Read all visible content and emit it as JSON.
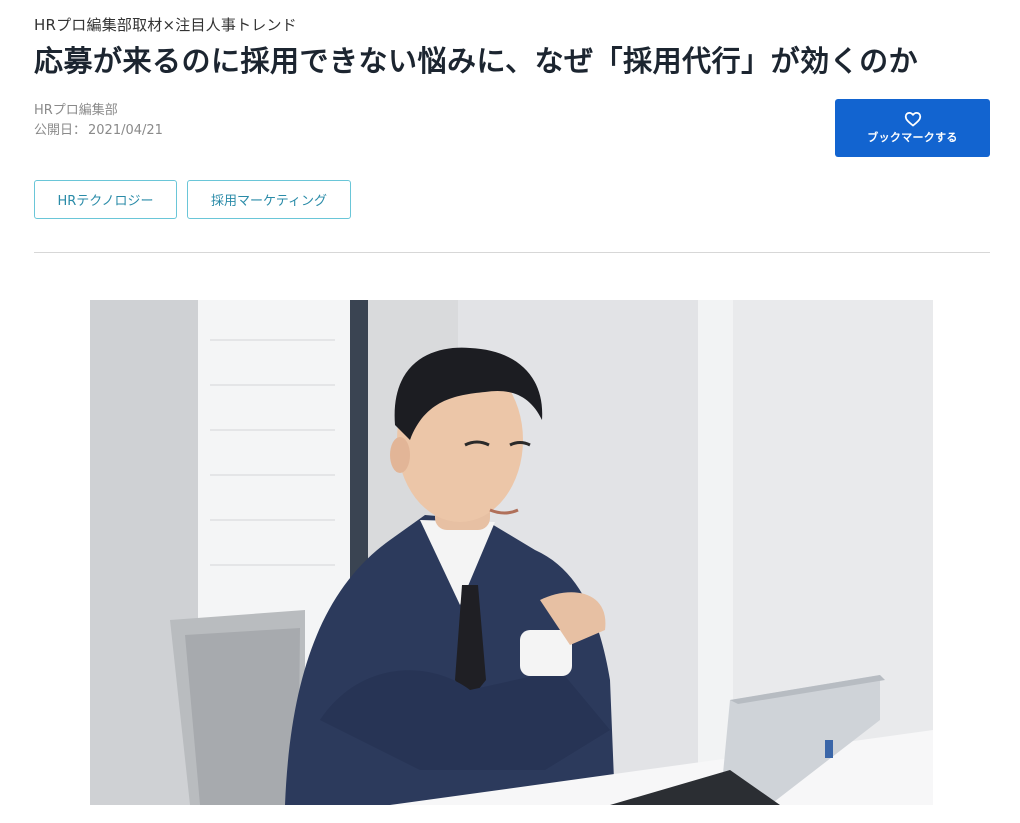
{
  "article": {
    "category": "HRプロ編集部取材×注目人事トレンド",
    "title": "応募が来るのに採用できない悩みに、なぜ「採用代行」が効くのか",
    "author": "HRプロ編集部",
    "date_label": "公開日：",
    "date": "2021/04/21"
  },
  "bookmark": {
    "label": "ブックマークする",
    "icon": "heart-outline-icon",
    "color": "#1264d0"
  },
  "tags": [
    {
      "label": "HRテクノロジー"
    },
    {
      "label": "採用マーケティング"
    }
  ],
  "hero_image": {
    "description_icon": "photo"
  }
}
